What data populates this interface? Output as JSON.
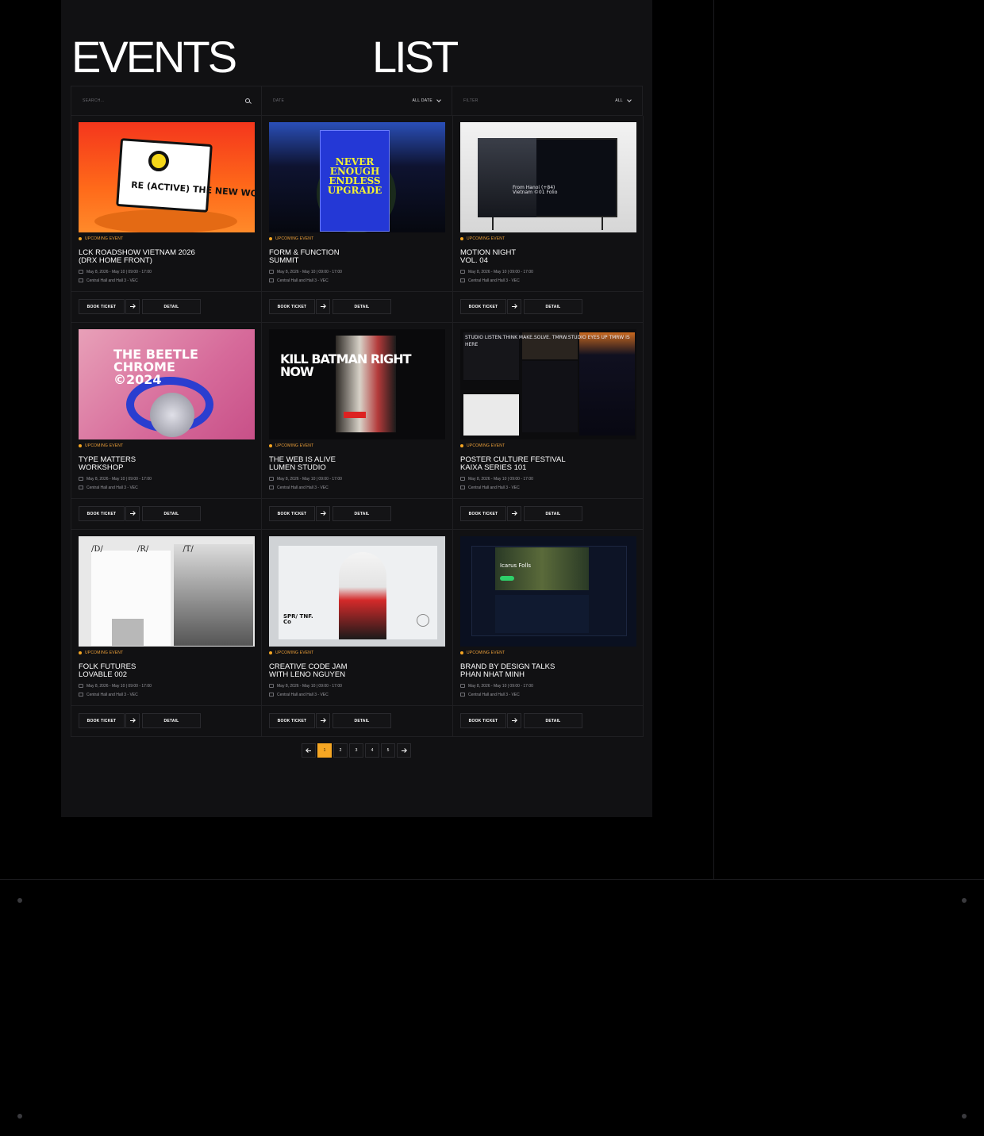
{
  "header": {
    "title_left": "EVENTS",
    "title_right": "LIST"
  },
  "filters": {
    "search": {
      "placeholder": "SEARCH..."
    },
    "date": {
      "label": "DATE",
      "value": "ALL DATE"
    },
    "filter": {
      "label": "FILTER",
      "value": "ALL"
    }
  },
  "events": [
    {
      "tag": "UPCOMING EVENT",
      "title": "LCK ROADSHOW VIETNAM 2026\n(DRX HOME FRONT)",
      "date": "May 8, 2026 - May 10   |   09:00 - 17:00",
      "venue": "Central Hall and Hall 3 - VEC",
      "thumb_text": "RE (ACTIVE) THE NEW WORLD"
    },
    {
      "tag": "UPCOMING EVENT",
      "title": "FORM & FUNCTION\nSUMMIT",
      "date": "May 8, 2026 - May 10   |   09:00 - 17:00",
      "venue": "Central Hall and Hall 3 - VEC",
      "thumb_text": "NEVER ENOUGH ENDLESS UPGRADE"
    },
    {
      "tag": "UPCOMING EVENT",
      "title": "MOTION NIGHT\nVOL. 04",
      "date": "May 8, 2026 - May 10   |   09:00 - 17:00",
      "venue": "Central Hall and Hall 3 - VEC",
      "thumb_text": "From Hanoi (+84) Vietnam ©01 Folio"
    },
    {
      "tag": "UPCOMING EVENT",
      "title": "TYPE MATTERS\nWORKSHOP",
      "date": "May 8, 2026 - May 10   |   09:00 - 17:00",
      "venue": "Central Hall and Hall 3 - VEC",
      "thumb_text": "THE BEETLE CHROME ©2024"
    },
    {
      "tag": "UPCOMING EVENT",
      "title": "THE WEB IS ALIVE\nLUMEN STUDIO",
      "date": "May 8, 2026 - May 10   |   09:00 - 17:00",
      "venue": "Central Hall and Hall 3 - VEC",
      "thumb_text": "KILL BATMAN RIGHT NOW"
    },
    {
      "tag": "UPCOMING EVENT",
      "title": "POSTER CULTURE FESTIVAL\nKAIXA SERIES 101",
      "date": "May 8, 2026 - May 10   |   09:00 - 17:00",
      "venue": "Central Hall and Hall 3 - VEC",
      "thumb_text": "STUDIO LISTEN.THINK MAKE.SOLVE. TMRW.STUDIO EYES UP TMRW IS HERE"
    },
    {
      "tag": "UPCOMING EVENT",
      "title": "FOLK FUTURES\nLOVABLE 002",
      "date": "May 8, 2026 - May 10   |   09:00 - 17:00",
      "venue": "Central Hall and Hall 3 - VEC",
      "thumb_text": "/D/ /R/ /T/"
    },
    {
      "tag": "UPCOMING EVENT",
      "title": "CREATIVE CODE JAM\nWITH LENO NGUYEN",
      "date": "May 8, 2026 - May 10   |   09:00 - 17:00",
      "venue": "Central Hall and Hall 3 - VEC",
      "thumb_text": "SPR/ TNF. Co"
    },
    {
      "tag": "UPCOMING EVENT",
      "title": "BRAND BY DESIGN TALKS\nPHAN NHAT MINH",
      "date": "May 8, 2026 - May 10   |   09:00 - 17:00",
      "venue": "Central Hall and Hall 3 - VEC",
      "thumb_text": "Icarus Folls"
    }
  ],
  "buttons": {
    "book": "BOOK TICKET",
    "detail": "DETAIL"
  },
  "pagination": {
    "pages": [
      "1",
      "2",
      "3",
      "4",
      "5"
    ],
    "current": "1"
  },
  "colors": {
    "accent": "#f5a623",
    "panel": "#111113",
    "background": "#000000"
  }
}
